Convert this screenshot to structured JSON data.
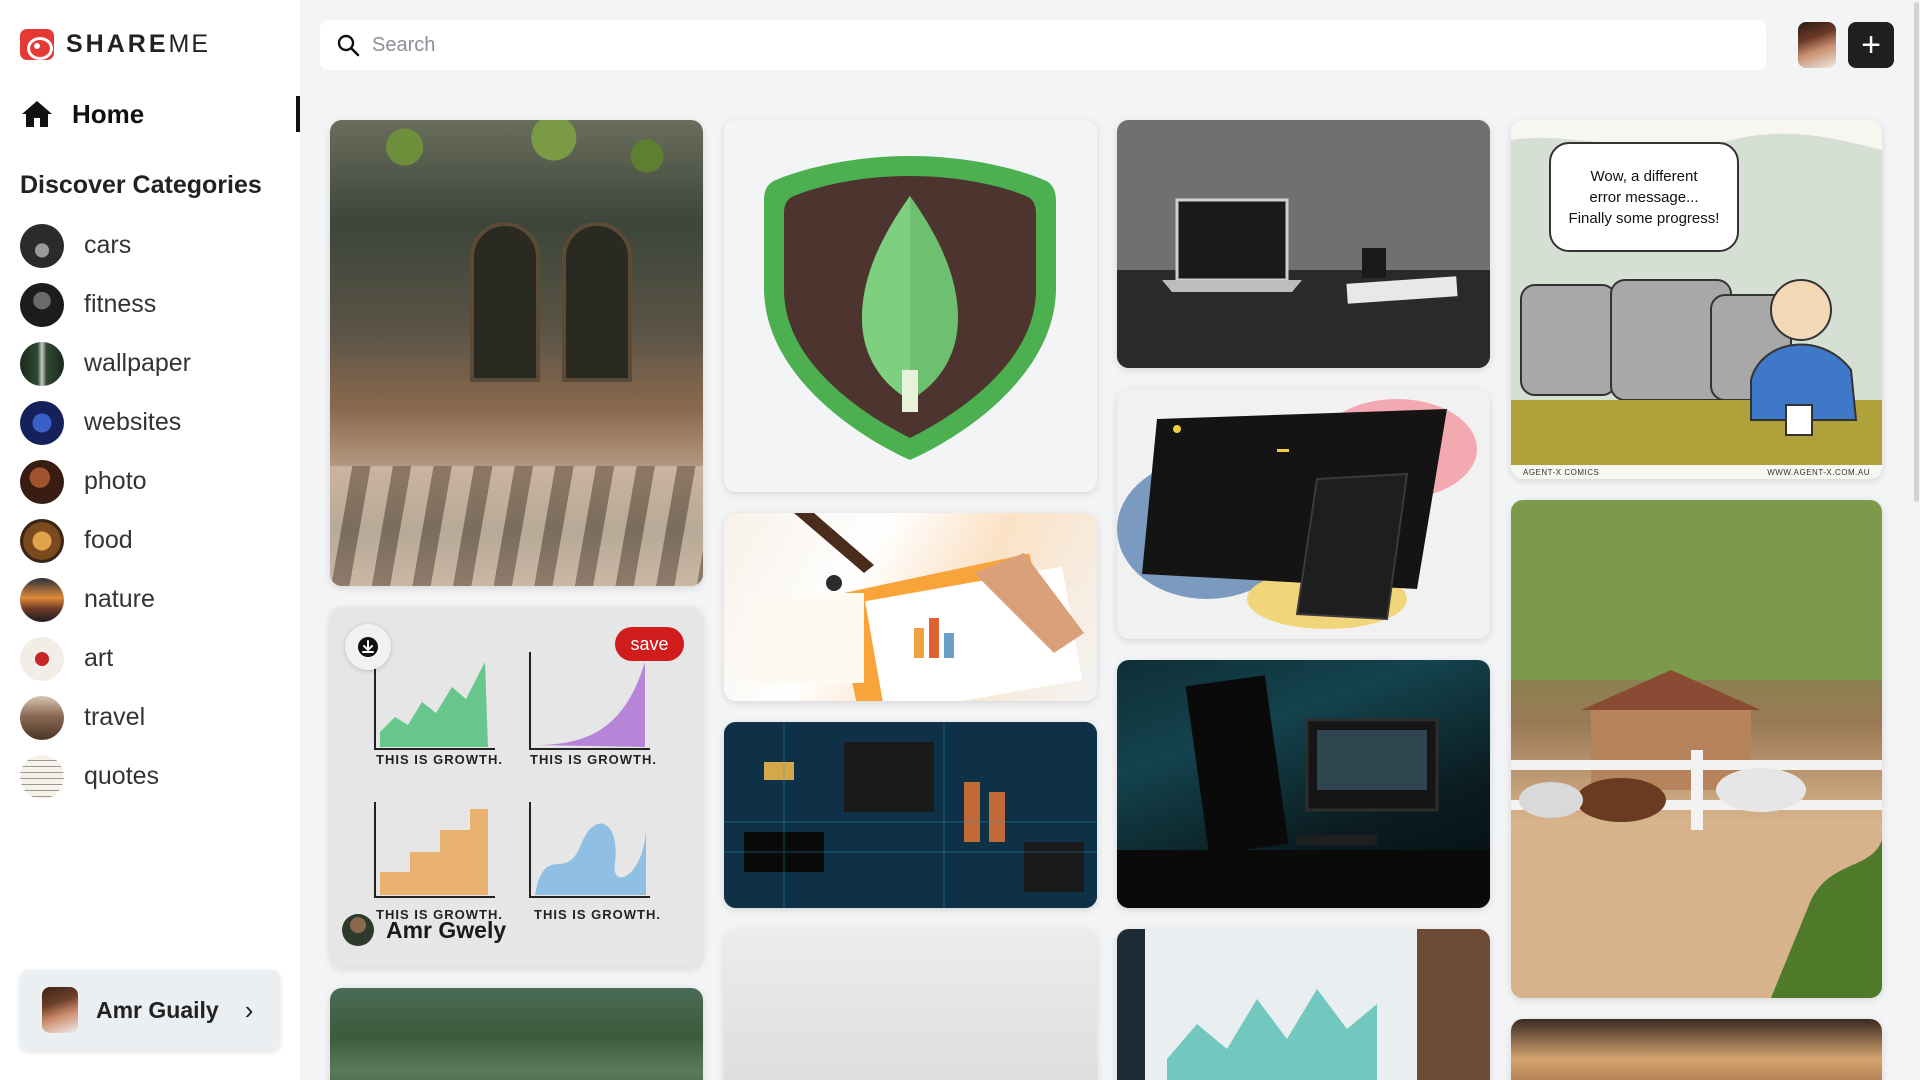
{
  "app": {
    "logo_share": "SHARE",
    "logo_me": "ME"
  },
  "nav": {
    "home_label": "Home",
    "categories_title": "Discover Categories",
    "categories": [
      {
        "label": "cars"
      },
      {
        "label": "fitness"
      },
      {
        "label": "wallpaper"
      },
      {
        "label": "websites"
      },
      {
        "label": "photo"
      },
      {
        "label": "food"
      },
      {
        "label": "nature"
      },
      {
        "label": "art"
      },
      {
        "label": "travel"
      },
      {
        "label": "quotes"
      }
    ]
  },
  "user": {
    "name": "Amr Guaily"
  },
  "search": {
    "placeholder": "Search",
    "value": ""
  },
  "pins": {
    "growth": {
      "captions": [
        "THIS IS GROWTH.",
        "THIS IS GROWTH.",
        "THIS IS GROWTH.",
        "THIS IS GROWTH."
      ],
      "save_label": "save",
      "owner_name": "Amr Gwely"
    },
    "comic": {
      "line1": "Wow, a different",
      "line2": "error message...",
      "line3": "Finally some progress!",
      "credit_left": "AGENT-X COMICS",
      "credit_right": "WWW.AGENT-X.COM.AU"
    }
  },
  "colors": {
    "brand": "#e53935",
    "save": "#d01c1c",
    "sidebar_bg": "#ffffff",
    "page_bg": "#f3f4f6"
  },
  "icons": {
    "logo": "camera-icon",
    "home": "home-icon",
    "search": "search-icon",
    "add": "plus-icon",
    "download": "download-icon",
    "chevron": "chevron-right-icon"
  }
}
